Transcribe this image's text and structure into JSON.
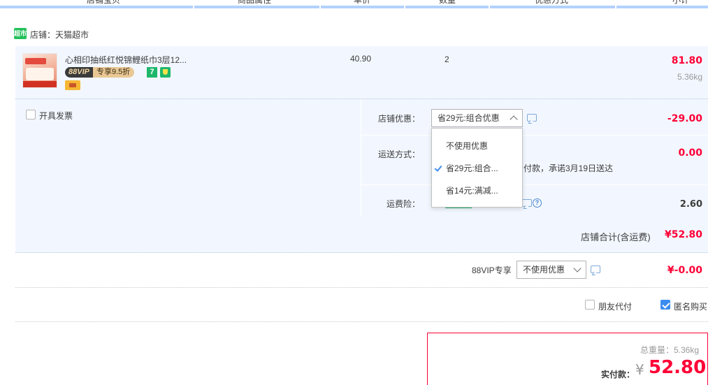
{
  "columns": [
    "店铺宝贝",
    "商品属性",
    "单价",
    "数量",
    "优惠方式",
    "小计"
  ],
  "store": {
    "icon_text": "超市",
    "label": "店铺：天猫超市"
  },
  "item": {
    "title": "心相印抽纸红悦锦鲤纸巾3层12...",
    "vip_badge": "88VIP",
    "vip_discount": "专享9.5折",
    "seven_day_icon": "7",
    "price": "40.90",
    "quantity": "2",
    "subtotal": "81.80",
    "weight": "5.36kg"
  },
  "invoice": {
    "label": "开具发票",
    "checked": false
  },
  "store_discount": {
    "label": "店铺优惠：",
    "selected": "省29元:组合优惠",
    "amount": "-29.00",
    "options": [
      {
        "label": "不使用优惠",
        "checked": false
      },
      {
        "label": "省29元:组合...",
        "checked": true
      },
      {
        "label": "省14元:满减...",
        "checked": false
      }
    ]
  },
  "shipping": {
    "label": "运送方式：",
    "amount": "0.00",
    "note": "付款，承诺3月19日送达"
  },
  "shipping_insurance": {
    "label": "运费险：",
    "amount": "2.60"
  },
  "store_total": {
    "label": "店铺合计(含运费)",
    "amount": "¥52.80"
  },
  "vip88": {
    "label": "88VIP专享",
    "selected": "不使用优惠",
    "amount": "¥-0.00"
  },
  "friend_pay": {
    "label": "朋友代付",
    "checked": false
  },
  "anonymous": {
    "label": "匿名购买",
    "checked": true
  },
  "summary": {
    "weight_label": "总重量：5.36kg",
    "pay_label": "实付款：",
    "currency": "¥",
    "pay_amount": "52.80"
  },
  "colors": {
    "accent_red": "#ff0036",
    "panel_blue": "#f2f7ff",
    "check_blue": "#3c8cf0"
  }
}
